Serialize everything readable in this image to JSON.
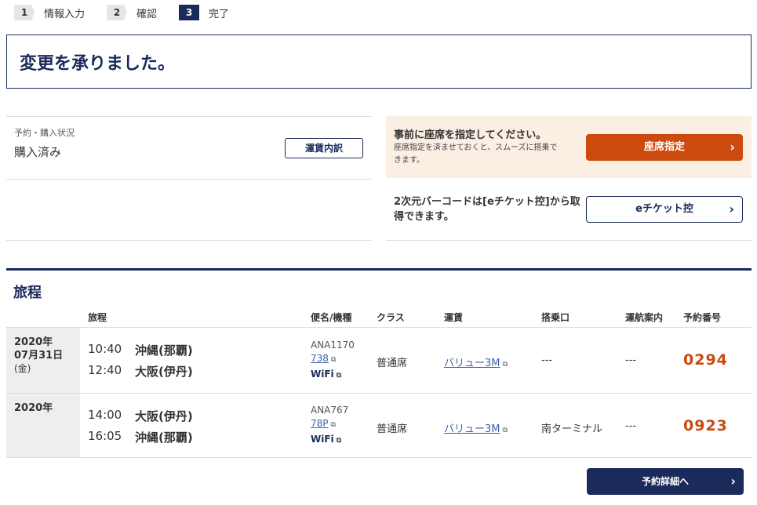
{
  "steps": [
    {
      "num": "1",
      "label": "情報入力"
    },
    {
      "num": "2",
      "label": "確認"
    },
    {
      "num": "3",
      "label": "完了"
    }
  ],
  "confirmation": {
    "title": "変更を承りました。"
  },
  "status": {
    "label": "予約・購入状況",
    "value": "購入済み",
    "fare_button": "運賃内訳"
  },
  "seat": {
    "title": "事前に座席を指定してください。",
    "description": "座席指定を済ませておくと、スムーズに搭乗できます。",
    "button": "座席指定"
  },
  "ticket": {
    "text": "2次元バーコードは[eチケット控]から取得できます。",
    "button": "eチケット控"
  },
  "itinerary": {
    "title": "旅程",
    "headers": {
      "route": "旅程",
      "flight": "便名/機種",
      "class": "クラス",
      "fare": "運賃",
      "gate": "搭乗口",
      "info": "運航案内",
      "resno": "予約番号"
    },
    "rows": [
      {
        "date_year": "2020年",
        "date_md": "07月31日",
        "date_dow": "(金)",
        "dep_time": "10:40",
        "dep_place": "沖縄(那覇)",
        "arr_time": "12:40",
        "arr_place": "大阪(伊丹)",
        "flight_no": "ANA1170",
        "aircraft": "738",
        "wifi": "WiFi",
        "class": "普通席",
        "fare": "バリュー3M",
        "gate": "---",
        "info": "---",
        "resno": "0294"
      },
      {
        "date_year": "2020年",
        "date_md": "",
        "date_dow": "",
        "dep_time": "14:00",
        "dep_place": "大阪(伊丹)",
        "arr_time": "16:05",
        "arr_place": "沖縄(那覇)",
        "flight_no": "ANA767",
        "aircraft": "78P",
        "wifi": "WiFi",
        "class": "普通席",
        "fare": "バリュー3M",
        "gate": "南ターミナル",
        "info": "---",
        "resno": "0923"
      }
    ]
  },
  "footer": {
    "detail_button": "予約詳細へ"
  },
  "icons": {
    "chevron": "chevron-right-icon",
    "window": "new-window-icon",
    "wifi": "wifi-icon"
  },
  "colors": {
    "navy": "#1a2a5a",
    "orange": "#cc4a0e",
    "seat_bg": "#fbeee3"
  }
}
